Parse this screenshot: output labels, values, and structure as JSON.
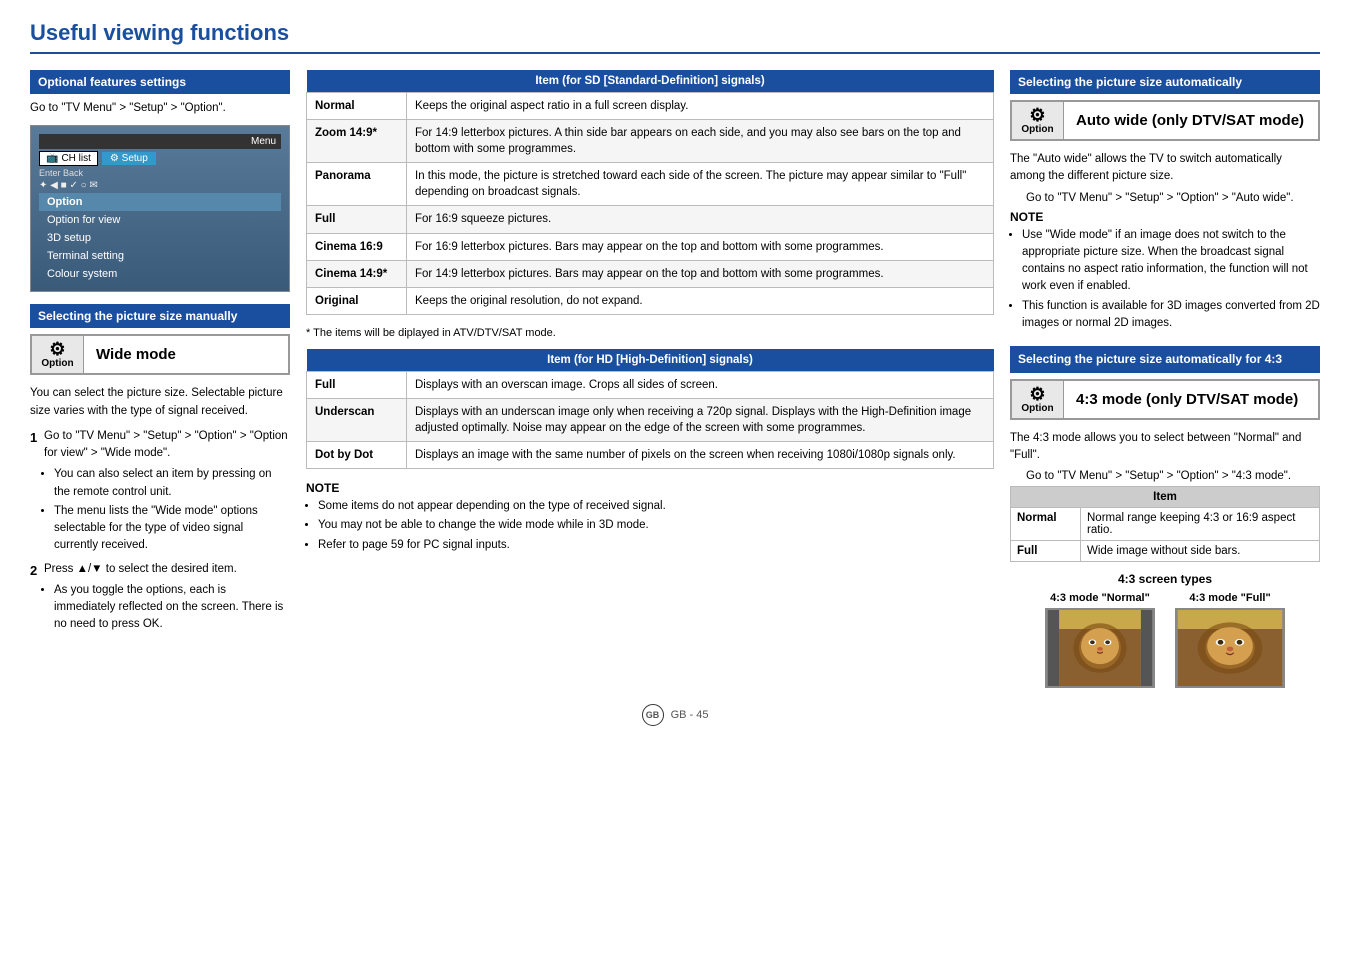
{
  "page": {
    "title": "Useful viewing functions",
    "page_number": "GB - 45"
  },
  "left": {
    "section_title": "Optional features settings",
    "intro_text": "Go to \"TV Menu\" > \"Setup\" > \"Option\".",
    "menu": {
      "top_label": "Menu",
      "ch_list": "CH list",
      "setup": "Setup",
      "nav": "Enter   Back",
      "option": "Option",
      "items": [
        {
          "label": "Option for view",
          "selected": false
        },
        {
          "label": "3D setup",
          "selected": false
        },
        {
          "label": "Terminal setting",
          "selected": false
        },
        {
          "label": "Colour system",
          "selected": false
        }
      ]
    },
    "manual_section_title": "Selecting the picture size manually",
    "option_label": "Option",
    "wide_mode_label": "Wide mode",
    "body_text": "You can select the picture size. Selectable picture size varies with the type of signal received.",
    "steps": [
      {
        "num": "1",
        "text": "Go to \"TV Menu\" > \"Setup\" > \"Option\" > \"Option for view\" > \"Wide mode\".",
        "bullets": [
          "You can also select an item by pressing  on the remote control unit.",
          "The menu lists the \"Wide mode\" options selectable for the type of video signal currently received."
        ]
      },
      {
        "num": "2",
        "text": "Press ▲/▼ to select the desired item.",
        "bullets": [
          "As you toggle the options, each is immediately reflected on the screen. There is no need to press OK."
        ]
      }
    ]
  },
  "center": {
    "sd_table_title": "Item (for SD [Standard-Definition] signals)",
    "sd_rows": [
      {
        "item": "Normal",
        "desc": "Keeps the original aspect ratio in a full screen display."
      },
      {
        "item": "Zoom 14:9*",
        "desc": "For 14:9 letterbox pictures. A thin side bar appears on each side, and you may also see bars on the top and bottom with some programmes."
      },
      {
        "item": "Panorama",
        "desc": "In this mode, the picture is stretched toward each side of the screen. The picture may appear similar to \"Full\" depending on broadcast signals."
      },
      {
        "item": "Full",
        "desc": "For 16:9 squeeze pictures."
      },
      {
        "item": "Cinema 16:9",
        "desc": "For 16:9 letterbox pictures. Bars may appear on the top and bottom with some programmes."
      },
      {
        "item": "Cinema 14:9*",
        "desc": "For 14:9 letterbox pictures. Bars may appear on the top and bottom with some programmes."
      },
      {
        "item": "Original",
        "desc": "Keeps the original resolution, do not expand."
      }
    ],
    "sd_footnote": "* The items will be diplayed in ATV/DTV/SAT mode.",
    "hd_table_title": "Item (for HD [High-Definition] signals)",
    "hd_rows": [
      {
        "item": "Full",
        "desc": "Displays with an overscan image. Crops all sides of screen."
      },
      {
        "item": "Underscan",
        "desc": "Displays with an underscan image only when receiving a 720p signal. Displays with the High-Definition image adjusted optimally. Noise may appear on the edge of the screen with some programmes."
      },
      {
        "item": "Dot by Dot",
        "desc": "Displays an image with the same number of pixels on the screen when receiving 1080i/1080p signals only."
      }
    ],
    "note_title": "NOTE",
    "note_bullets": [
      "Some items do not appear depending on the type of received signal.",
      "You may not be able to change the wide mode while in 3D mode.",
      "Refer to page 59 for PC signal inputs."
    ]
  },
  "right": {
    "auto_section_title": "Selecting the picture size automatically",
    "auto_option_label": "Option",
    "auto_wide_label": "Auto wide (only DTV/SAT mode)",
    "auto_body": "The \"Auto wide\" allows the TV to switch automatically among the different picture size.",
    "auto_go_to": "Go to \"TV Menu\" > \"Setup\" > \"Option\" > \"Auto wide\".",
    "note_title": "NOTE",
    "auto_note_bullets": [
      "Use \"Wide mode\" if an image does not switch to the appropriate picture size. When the broadcast signal contains no aspect ratio information, the function will not work even if enabled.",
      "This function is available for 3D images converted from 2D images or normal 2D images."
    ],
    "for43_section_title": "Selecting the picture size automatically for 4:3",
    "for43_option_label": "Option",
    "for43_mode_label": "4:3 mode (only DTV/SAT mode)",
    "for43_body": "The 4:3 mode allows you to select between \"Normal\" and \"Full\".",
    "for43_go_to": "Go to \"TV Menu\" > \"Setup\" > \"Option\" > \"4:3 mode\".",
    "for43_table_header": "Item",
    "for43_rows": [
      {
        "item": "Normal",
        "desc": "Normal range keeping 4:3 or 16:9 aspect ratio."
      },
      {
        "item": "Full",
        "desc": "Wide image without side bars."
      }
    ],
    "screen_types_title": "4:3 screen types",
    "screen_normal_label": "4:3 mode\n\"Normal\"",
    "screen_full_label": "4:3 mode\n\"Full\""
  }
}
